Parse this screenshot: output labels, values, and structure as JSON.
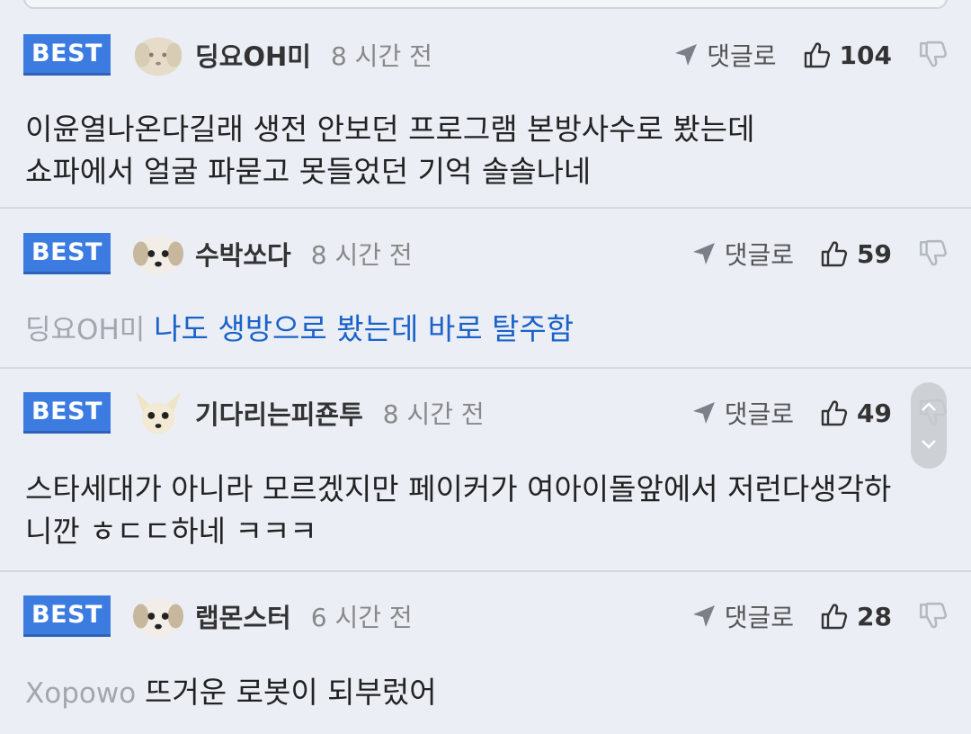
{
  "comments": [
    {
      "badge": "BEST",
      "avatar": "dog-avatar",
      "nickname": "딩요OH미",
      "time": "8 시간 전",
      "reply_label": "댓글로",
      "likes": "104",
      "mention": "",
      "lines": [
        "이윤열나온다길래 생전 안보던 프로그램 본방사수로 봤는데",
        "쇼파에서 얼굴 파묻고 못들었던 기억 솔솔나네"
      ]
    },
    {
      "badge": "BEST",
      "avatar": "dog-avatar",
      "nickname": "수박쏘다",
      "time": "8 시간 전",
      "reply_label": "댓글로",
      "likes": "59",
      "mention": "딩요OH미",
      "lines": [
        "나도 생방으로 봤는데 바로 탈주함"
      ]
    },
    {
      "badge": "BEST",
      "avatar": "chihuahua-avatar",
      "nickname": "기다리는피죤투",
      "time": "8 시간 전",
      "reply_label": "댓글로",
      "likes": "49",
      "mention": "",
      "lines": [
        "스타세대가 아니라 모르겠지만 페이커가 여아이돌앞에서 저런다생각하",
        "니깐 ㅎㄷㄷ하네 ㅋㅋㅋ"
      ]
    },
    {
      "badge": "BEST",
      "avatar": "dog-avatar",
      "nickname": "랩몬스터",
      "time": "6 시간 전",
      "reply_label": "댓글로",
      "likes": "28",
      "mention": "Xopowo",
      "lines": [
        "뜨거운 로봇이 되부렀어"
      ]
    }
  ],
  "colors": {
    "badge": "#3c7be0",
    "reply_text": "#1b63c9",
    "background": "#ebeef5"
  }
}
